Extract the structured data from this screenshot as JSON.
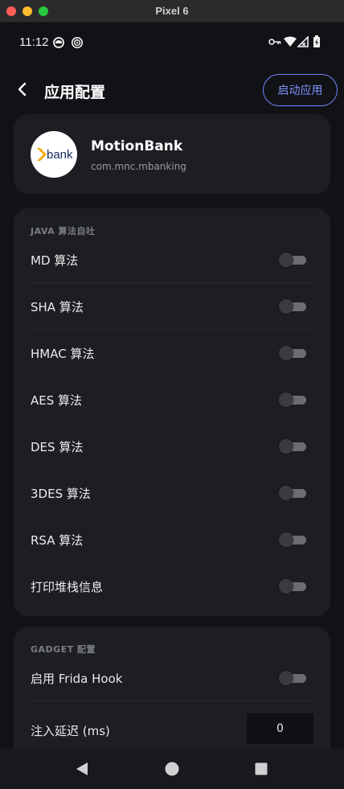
{
  "window": {
    "title": "Pixel 6"
  },
  "status": {
    "time": "11:12"
  },
  "appbar": {
    "title": "应用配置",
    "launch_label": "启动应用"
  },
  "app": {
    "name": "MotionBank",
    "package": "com.mnc.mbanking",
    "logo_text": "bank"
  },
  "java_section": {
    "title": "JAVA 算法自吐",
    "items": [
      {
        "label": "MD 算法",
        "enabled": false
      },
      {
        "label": "SHA 算法",
        "enabled": false
      },
      {
        "label": "HMAC 算法",
        "enabled": false
      },
      {
        "label": "AES 算法",
        "enabled": false
      },
      {
        "label": "DES 算法",
        "enabled": false
      },
      {
        "label": "3DES 算法",
        "enabled": false
      },
      {
        "label": "RSA 算法",
        "enabled": false
      },
      {
        "label": "打印堆栈信息",
        "enabled": false
      }
    ]
  },
  "gadget_section": {
    "title": "GADGET 配置",
    "frida_label": "启用 Frida Hook",
    "frida_enabled": false,
    "delay_label": "注入延迟 (ms)",
    "delay_value": "0"
  },
  "colors": {
    "accent": "#7f93ff",
    "card": "#1d1e23",
    "background": "#111216"
  },
  "icons": [
    "back-arrow-icon",
    "key-icon",
    "wifi-icon",
    "signal-icon",
    "battery-icon",
    "nav-back-icon",
    "nav-home-icon",
    "nav-recents-icon"
  ]
}
